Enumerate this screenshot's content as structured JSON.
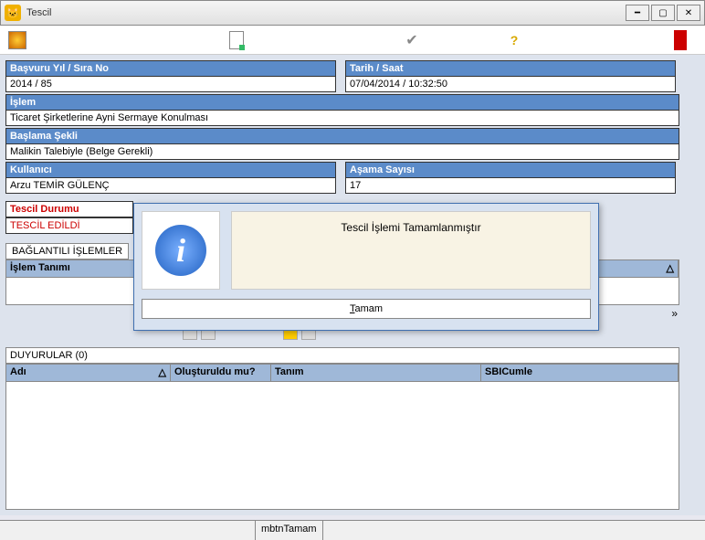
{
  "window": {
    "title": "Tescil"
  },
  "fields": {
    "basvuru_label": "Başvuru Yıl / Sıra No",
    "basvuru_value": "2014 / 85",
    "tarih_label": "Tarih / Saat",
    "tarih_value": "07/04/2014 / 10:32:50",
    "islem_label": "İşlem",
    "islem_value": "Ticaret Şirketlerine Ayni Sermaye Konulması",
    "baslama_label": "Başlama Şekli",
    "baslama_value": "Malikin Talebiyle (Belge Gerekli)",
    "kullanici_label": "Kullanıcı",
    "kullanici_value": "Arzu TEMİR GÜLENÇ",
    "asama_label": "Aşama Sayısı",
    "asama_value": "17",
    "tescil_durumu_label": "Tescil Durumu",
    "tescil_durumu_value": "TESCİL EDİLDİ"
  },
  "linked": {
    "header": "BAĞLANTILI İŞLEMLER",
    "col1": "İşlem Tanımı"
  },
  "duyurular": {
    "header": "DUYURULAR (0)",
    "cols": {
      "adi": "Adı",
      "olusturuldu": "Oluşturuldu mu?",
      "tanim": "Tanım",
      "sbicumle": "SBICumle"
    }
  },
  "statusbar": {
    "hint": "mbtnTamam"
  },
  "dialog": {
    "message": "Tescil İşlemi Tamamlanmıştır",
    "ok": "Tamam"
  }
}
